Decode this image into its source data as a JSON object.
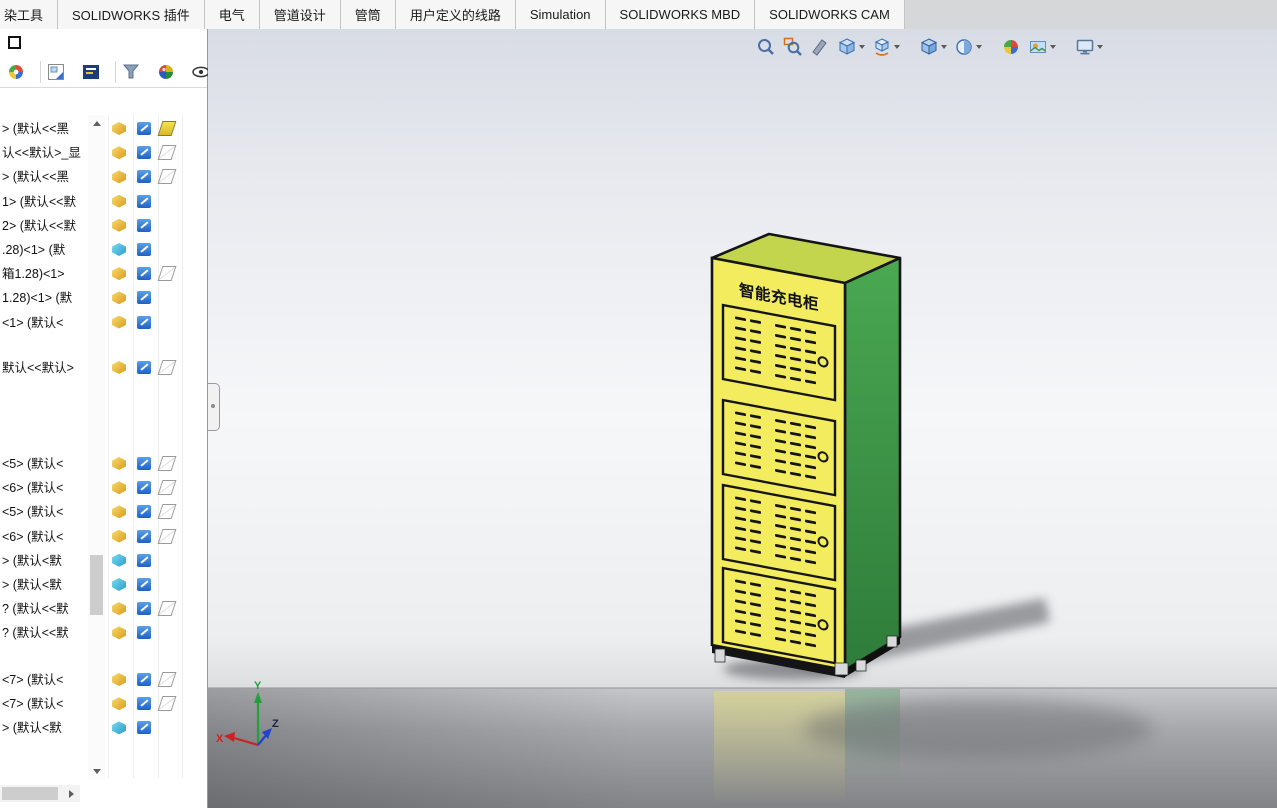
{
  "window": {
    "tabs": [
      "染工具",
      "SOLIDWORKS 插件",
      "电气",
      "管道设计",
      "管筒",
      "用户定义的线路",
      "Simulation",
      "SOLIDWORKS MBD",
      "SOLIDWORKS CAM"
    ]
  },
  "left_panel": {
    "tree_rows": [
      "> (默认<<黑",
      "认<<默认>_显",
      "> (默认<<黑",
      "1> (默认<<默",
      "2> (默认<<默",
      ".28)<1> (默",
      "箱1.28)<1>",
      "1.28)<1> (默",
      "<1> (默认<",
      "默认<<默认>",
      "<5> (默认<",
      "<6> (默认<",
      "<5> (默认<",
      "<6> (默认<",
      "> (默认<默",
      "> (默认<默",
      "? (默认<<默",
      "? (默认<<默",
      "<7> (默认<",
      "<7> (默认<",
      "> (默认<默"
    ]
  },
  "viewport": {
    "model_label": "智能充电柜",
    "triad": {
      "x_label": "X",
      "y_label": "Y",
      "z_label": "Z"
    },
    "colors": {
      "cabinet_front": "#f2ec5e",
      "cabinet_side": "#3ea24c",
      "cabinet_top": "#c3d44d",
      "outline": "#151515",
      "triad_x": "#cc2222",
      "triad_y": "#22a03c",
      "triad_z": "#2244cc"
    }
  },
  "icons": {
    "panel_corner": "panel-anchor-icon",
    "panel_header": [
      "appearances-icon",
      "decals-icon",
      "lights-icon",
      "filter-icon",
      "render-tools-icon",
      "eye-icon"
    ],
    "view_toolbar": [
      "zoom-fit-icon",
      "zoom-area-icon",
      "section-view-icon",
      "view-orientation-icon",
      "3d-drawing-view-icon",
      "display-style-icon",
      "hide-show-items-icon",
      "edit-appearance-icon",
      "apply-scene-icon",
      "view-settings-icon"
    ],
    "tree_row_icons": [
      "part-icon",
      "display-state-icon",
      "appearance-icon"
    ]
  }
}
